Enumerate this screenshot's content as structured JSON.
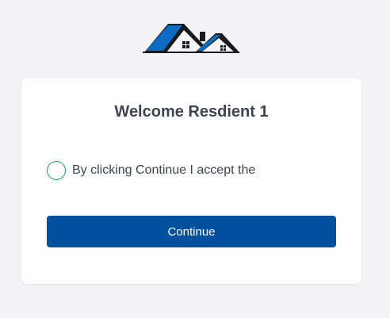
{
  "header": {
    "logo_icon": "houses-logo-icon"
  },
  "card": {
    "title": "Welcome Resdient 1",
    "consent_text": "By clicking Continue I accept the",
    "continue_label": "Continue"
  },
  "colors": {
    "page_background": "#f4f4f6",
    "card_background": "#ffffff",
    "primary_button": "#0050a0",
    "radio_border": "#1fa25a",
    "text": "#3d4450",
    "logo_blue": "#0d6bc4",
    "logo_dark": "#1a1a1a"
  }
}
